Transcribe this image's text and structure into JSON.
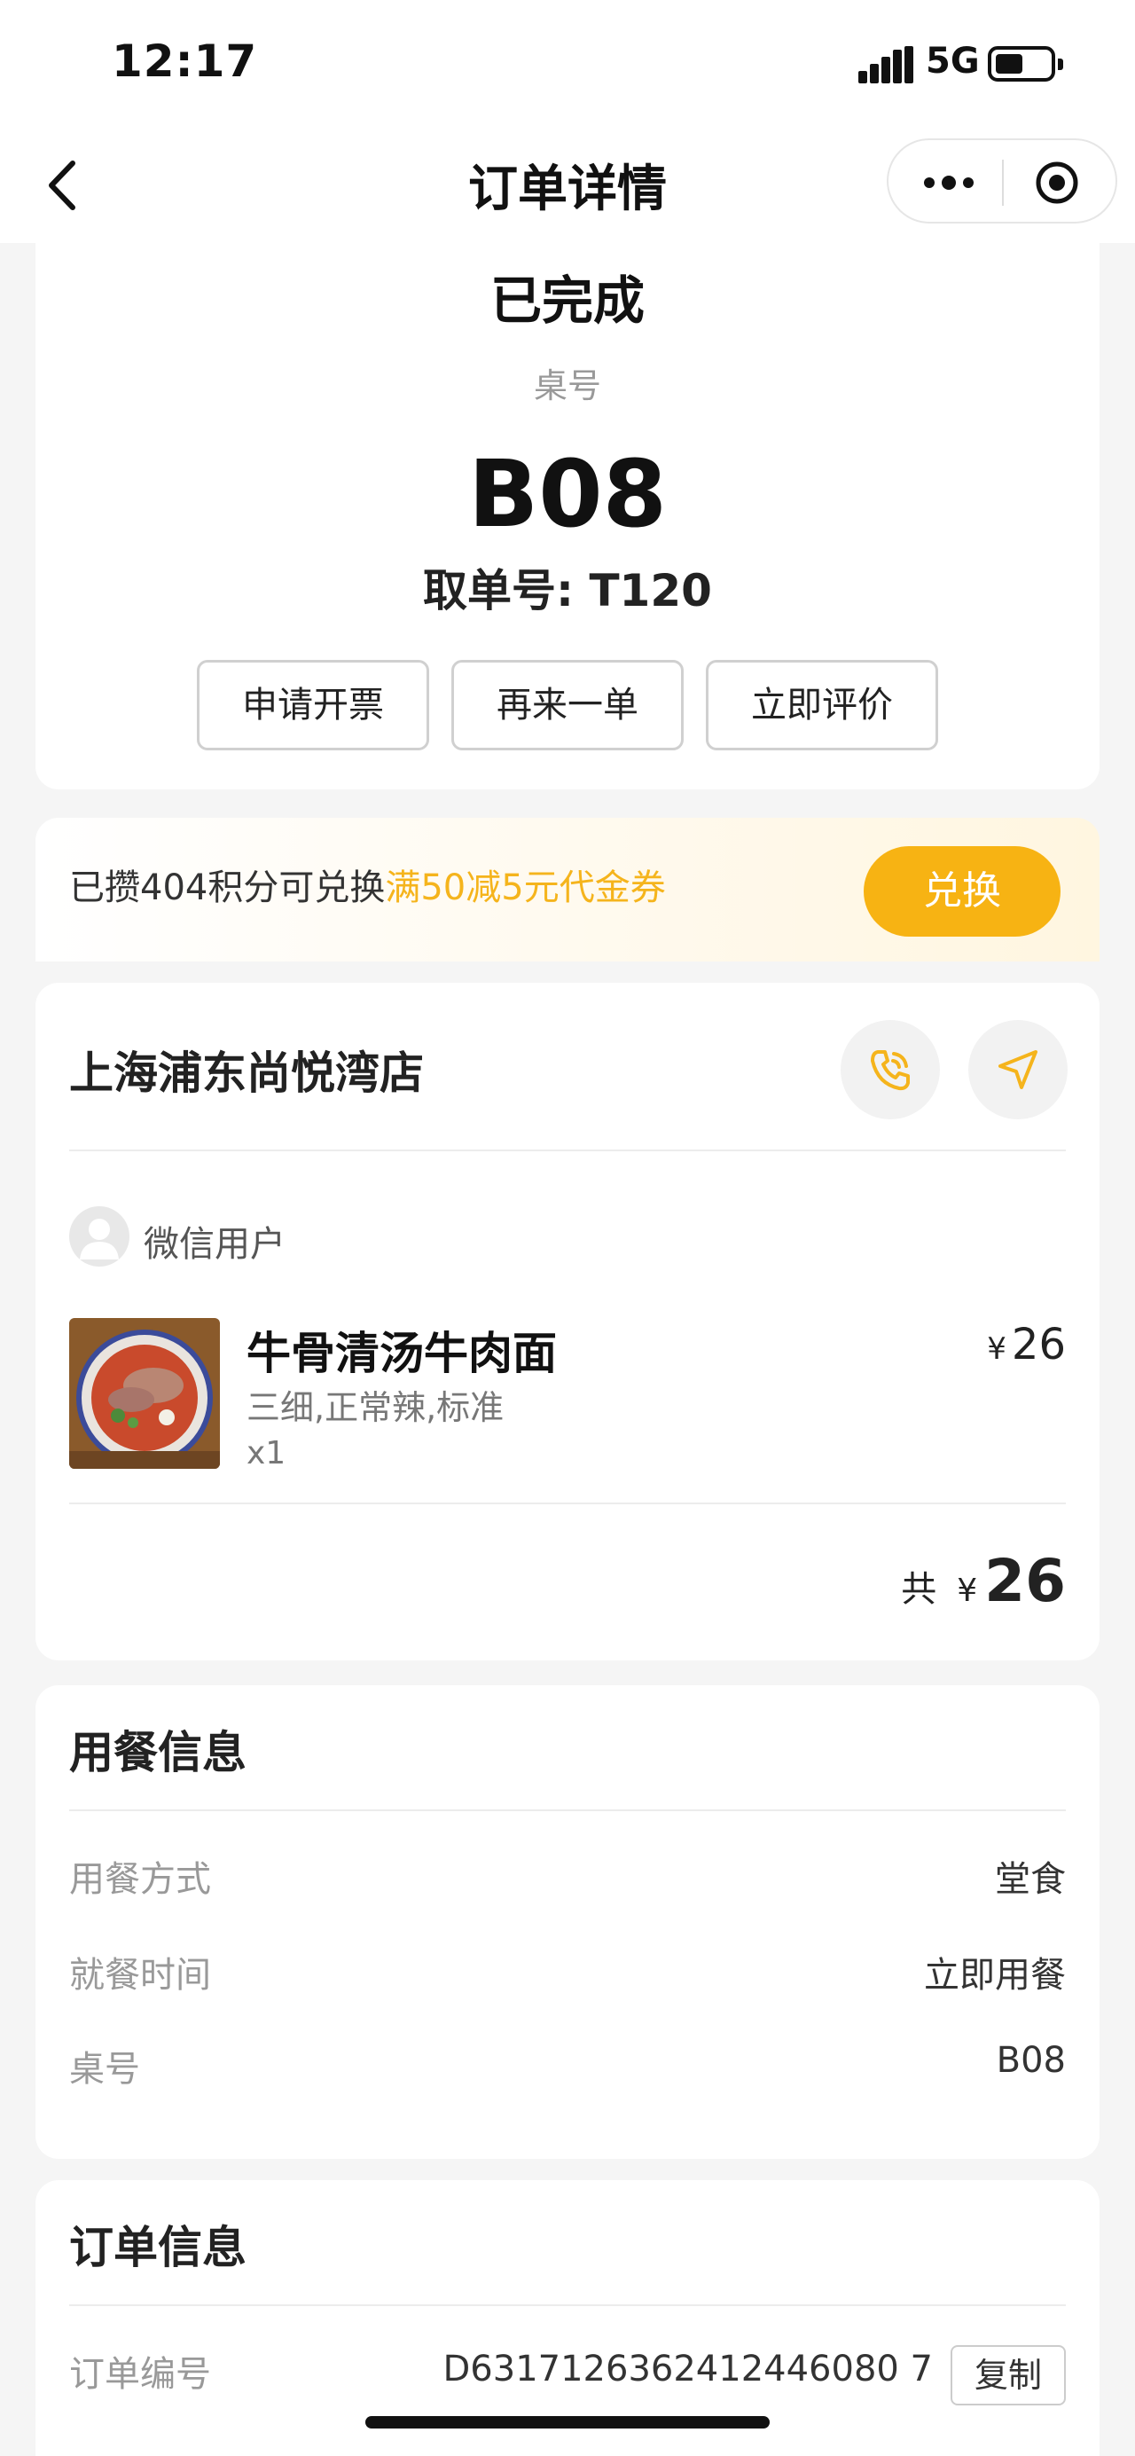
{
  "status_bar": {
    "time": "12:17",
    "network": "5G"
  },
  "nav": {
    "title": "订单详情"
  },
  "order_status": {
    "status": "已完成",
    "table_label": "桌号",
    "table_no": "B08",
    "pickup": "取单号: T120",
    "buttons": [
      "申请开票",
      "再来一单",
      "立即评价"
    ]
  },
  "points": {
    "prefix": "已攒404积分可兑换",
    "highlight": "满50减5元代金券",
    "button": "兑换",
    "accent": "#f7b313"
  },
  "store": {
    "name": "上海浦东尚悦湾店",
    "user": "微信用户",
    "dish": {
      "name": "牛骨清汤牛肉面",
      "spec": "三细,正常辣,标准",
      "qty": "x1",
      "currency": "¥",
      "price": "26"
    },
    "total_label": "共",
    "total_currency": "¥",
    "total": "26"
  },
  "dining": {
    "title": "用餐信息",
    "rows": [
      {
        "label": "用餐方式",
        "value": "堂食"
      },
      {
        "label": "就餐时间",
        "value": "立即用餐"
      },
      {
        "label": "桌号",
        "value": "B08"
      }
    ]
  },
  "order": {
    "title": "订单信息",
    "number_label": "订单编号",
    "number": "D6317126362412446080 7",
    "copy": "复制"
  }
}
